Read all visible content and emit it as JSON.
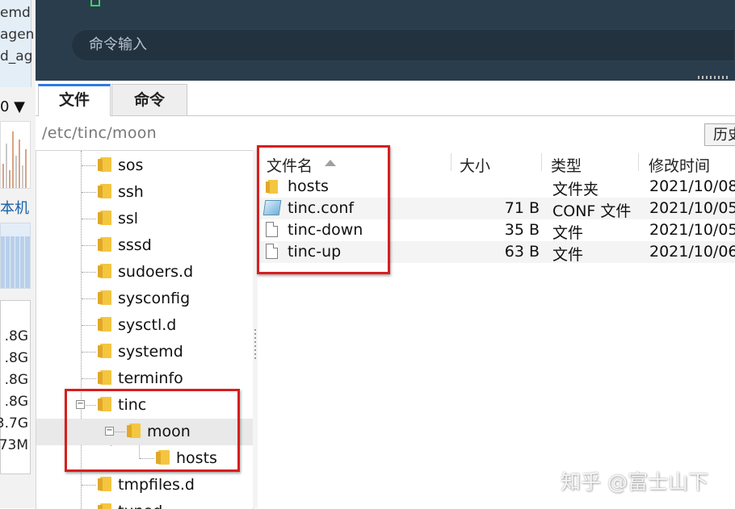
{
  "left_panel": {
    "top_lines": [
      "emd",
      "agen",
      "d_ag"
    ],
    "dropdown_label": "0 ▼",
    "local_label": "本机",
    "sizes": [
      ".8G",
      ".8G",
      ".8G",
      ".8G",
      "3.7G",
      "73M"
    ]
  },
  "terminal": {
    "command_placeholder": "命令输入"
  },
  "tabs": [
    {
      "label": "文件",
      "active": true
    },
    {
      "label": "命令",
      "active": false
    }
  ],
  "path_bar": {
    "path": "/etc/tinc/moon",
    "history_label": "历史"
  },
  "tree": {
    "items": [
      {
        "label": "sos",
        "level": 0
      },
      {
        "label": "ssh",
        "level": 0
      },
      {
        "label": "ssl",
        "level": 0
      },
      {
        "label": "sssd",
        "level": 0
      },
      {
        "label": "sudoers.d",
        "level": 0
      },
      {
        "label": "sysconfig",
        "level": 0
      },
      {
        "label": "sysctl.d",
        "level": 0
      },
      {
        "label": "systemd",
        "level": 0
      },
      {
        "label": "terminfo",
        "level": 0
      },
      {
        "label": "tinc",
        "level": 0,
        "expanded": true
      },
      {
        "label": "moon",
        "level": 1,
        "expanded": true,
        "selected": true
      },
      {
        "label": "hosts",
        "level": 2
      },
      {
        "label": "tmpfiles.d",
        "level": 0
      },
      {
        "label": "tuned",
        "level": 0
      }
    ]
  },
  "file_list": {
    "columns": {
      "name": "文件名",
      "size": "大小",
      "type": "类型",
      "modified": "修改时间"
    },
    "sort": {
      "column": "name",
      "direction": "ascending"
    },
    "rows": [
      {
        "name": "hosts",
        "size": "",
        "type": "文件夹",
        "modified": "2021/10/08",
        "icon": "folder-icon"
      },
      {
        "name": "tinc.conf",
        "size": "71 B",
        "type": "CONF 文件",
        "modified": "2021/10/05",
        "icon": "conf-file-icon"
      },
      {
        "name": "tinc-down",
        "size": "35 B",
        "type": "文件",
        "modified": "2021/10/05",
        "icon": "file-icon"
      },
      {
        "name": "tinc-up",
        "size": "63 B",
        "type": "文件",
        "modified": "2021/10/06",
        "icon": "file-icon"
      }
    ]
  },
  "colors": {
    "highlight_box": "#d81e1e",
    "terminal_bg": "#2a3d4d",
    "active_tab_accent": "#2c7be5",
    "folder": "#f4c640"
  },
  "watermark": "知乎 @富士山下"
}
